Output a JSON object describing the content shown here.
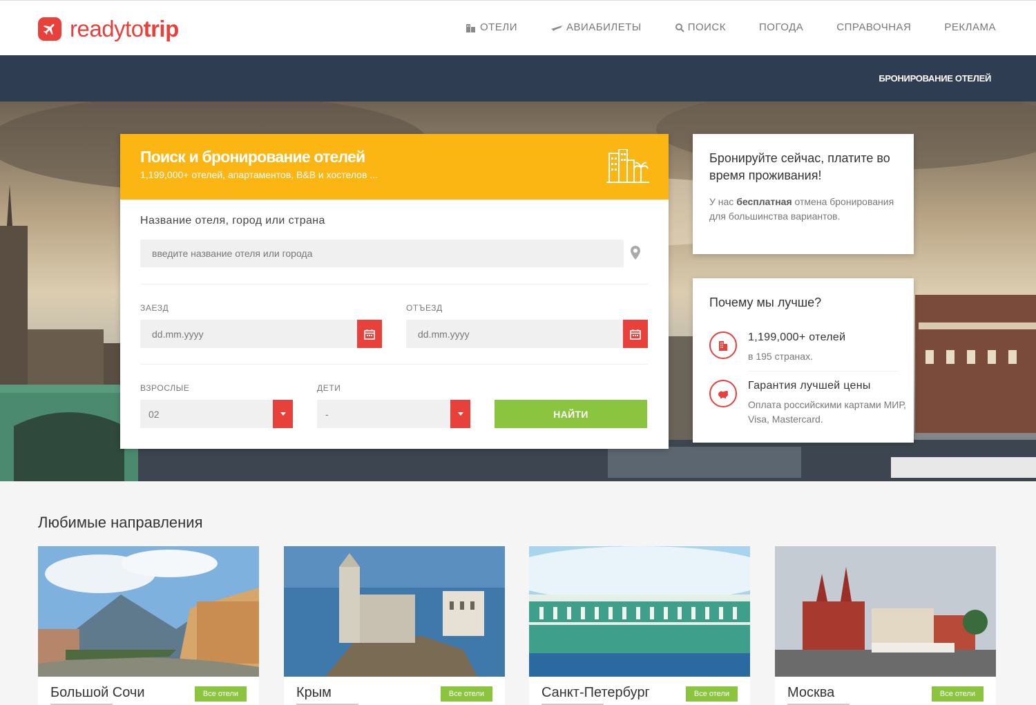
{
  "header": {
    "logo_text_light": "readyto",
    "logo_text_bold": "trip",
    "nav": [
      {
        "label": "ОТЕЛИ",
        "icon": "hotel-icon"
      },
      {
        "label": "АВИАБИЛЕТЫ",
        "icon": "plane-icon"
      },
      {
        "label": "ПОИСК",
        "icon": "search-icon"
      },
      {
        "label": "ПОГОДА",
        "icon": ""
      },
      {
        "label": "СПРАВОЧНАЯ",
        "icon": ""
      },
      {
        "label": "РЕКЛАМА",
        "icon": ""
      }
    ]
  },
  "band": {
    "label": "БРОНИРОВАНИЕ ОТЕЛЕЙ"
  },
  "search": {
    "title": "Поиск и бронирование отелей",
    "subtitle": "1,199,000+ отелей, апартаментов, B&B и хостелов ...",
    "destination_label": "Название отеля, город или страна",
    "destination_placeholder": "введите название отеля или города",
    "checkin_label": "ЗАЕЗД",
    "checkin_placeholder": "dd.mm.yyyy",
    "checkout_label": "ОТЪЕЗД",
    "checkout_placeholder": "dd.mm.yyyy",
    "adults_label": "ВЗРОСЛЫЕ",
    "adults_value": "02",
    "children_label": "ДЕТИ",
    "children_value": "-",
    "find_label": "НАЙТИ"
  },
  "promo": {
    "title": "Бронируйте сейчас, платите во время проживания!",
    "text_before": "У нас ",
    "text_bold": "бесплатная",
    "text_after": " отмена бронирования для большинства вариантов."
  },
  "why": {
    "title": "Почему мы лучше?",
    "features": [
      {
        "title": "1,199,000+ отелей",
        "desc": "в 195 странах."
      },
      {
        "title": "Гарантия лучшей цены",
        "desc": "Оплата российскими картами МИР, Visa, Mastercard."
      }
    ]
  },
  "destinations": {
    "title": "Любимые направления",
    "button_label": "Все отели",
    "items": [
      {
        "name": "Большой Сочи"
      },
      {
        "name": "Крым"
      },
      {
        "name": "Санкт-Петербург"
      },
      {
        "name": "Москва"
      }
    ]
  },
  "colors": {
    "accent": "#e8413c",
    "yellow": "#fbb614",
    "green": "#8bc53f",
    "band": "#2f3d52"
  }
}
